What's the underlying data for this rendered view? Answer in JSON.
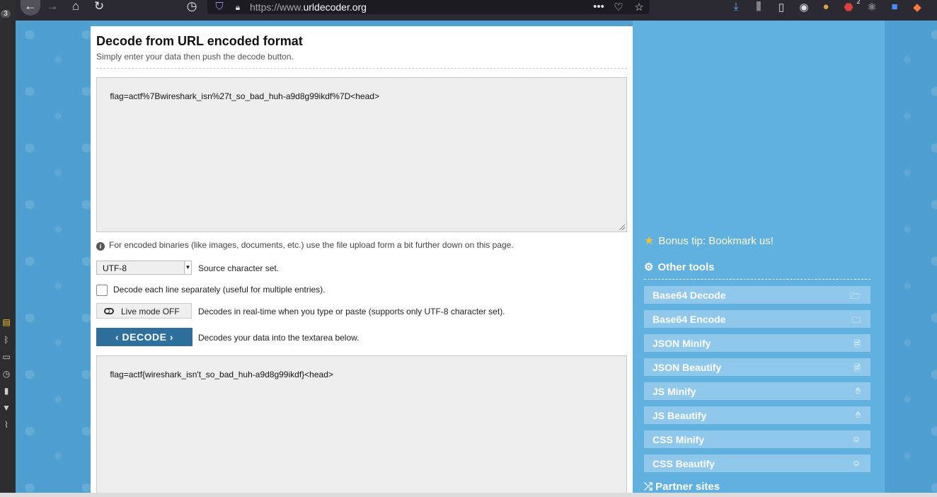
{
  "browser": {
    "url_prefix": "https://www.",
    "url_domain": "urldecoder.org",
    "abp_badge": "2",
    "tab_count": "3"
  },
  "main": {
    "title": "Decode from URL encoded format",
    "subtitle": "Simply enter your data then push the decode button.",
    "input_value": "flag=actf%7Bwireshark_isn%27t_so_bad_huh-a9d8g99ikdf%7D<head>",
    "info_text": "For encoded binaries (like images, documents, etc.) use the file upload form a bit further down on this page.",
    "charset_value": "UTF-8",
    "charset_label": "Source character set.",
    "each_line_label": "Decode each line separately (useful for multiple entries).",
    "live_mode_label": "Live mode OFF",
    "live_mode_desc": "Decodes in real-time when you type or paste (supports only UTF-8 character set).",
    "decode_label": "DECODE",
    "decode_desc": "Decodes your data into the textarea below.",
    "output_value": "flag=actf{wireshark_isn't_so_bad_huh-a9d8g99ikdf}<head>"
  },
  "sidebar": {
    "bonus_tip": "Bonus tip: Bookmark us!",
    "other_tools_title": "Other tools",
    "tools": [
      {
        "label": "Base64 Decode",
        "icon": "folder-open-icon"
      },
      {
        "label": "Base64 Encode",
        "icon": "folder-icon"
      },
      {
        "label": "JSON Minify",
        "icon": "file-icon"
      },
      {
        "label": "JSON Beautify",
        "icon": "file-code-icon"
      },
      {
        "label": "JS Minify",
        "icon": "hand-icon"
      },
      {
        "label": "JS Beautify",
        "icon": "hand-icon"
      },
      {
        "label": "CSS Minify",
        "icon": "smile-icon"
      },
      {
        "label": "CSS Beautify",
        "icon": "smile-icon"
      }
    ],
    "partner_title": "Partner sites"
  },
  "colors": {
    "page_bg": "#4f9fd0",
    "decode_button": "#2f6f9e",
    "tool_item": "#8fc8ea"
  }
}
